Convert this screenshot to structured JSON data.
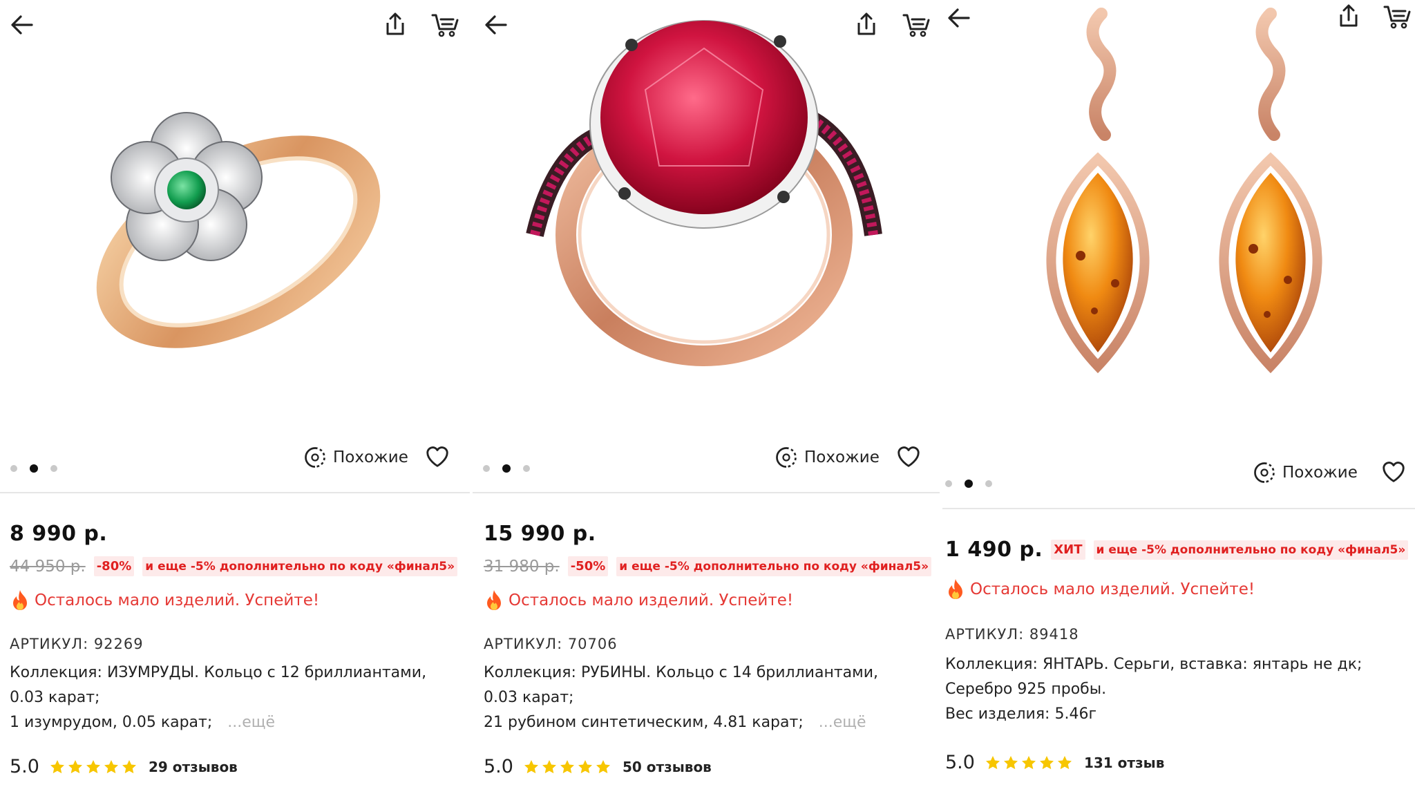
{
  "colors": {
    "accent": "#e53935",
    "badge_bg": "#fdeaea",
    "star": "#f7c600",
    "old_price": "#9a9a9a"
  },
  "icons": [
    "arrow-left-icon",
    "share-icon",
    "cart-icon",
    "similar-icon",
    "heart-icon",
    "fire-icon",
    "star-icon"
  ],
  "panels": [
    {
      "product": "emerald flower ring",
      "price": "8 990 р.",
      "old_price": "44 950 р.",
      "discount": "-80%",
      "promo": "и еще -5% дополнительно по коду «финал5»",
      "similar_label": "Похожие",
      "stock_warning": "Осталось мало изделий. Успейте!",
      "sku": "АРТИКУЛ: 92269",
      "description": [
        "Коллекция: ИЗУМРУДЫ. Кольцо с 12 бриллиантами,",
        "0.03 карат;",
        "1 изумрудом, 0.05 карат;"
      ],
      "more_label": "...ещё",
      "rating": "5.0",
      "stars": 5,
      "reviews": "29 отзывов",
      "active_slide": 2,
      "slides": 3
    },
    {
      "product": "ruby ring",
      "price": "15 990 р.",
      "old_price": "31 980 р.",
      "discount": "-50%",
      "promo": "и еще -5% дополнительно по коду «финал5»",
      "similar_label": "Похожие",
      "stock_warning": "Осталось мало изделий. Успейте!",
      "sku": "АРТИКУЛ: 70706",
      "description": [
        "Коллекция: РУБИНЫ. Кольцо с 14 бриллиантами,",
        "0.03 карат;",
        "21 рубином синтетическим, 4.81 карат;"
      ],
      "more_label": "...ещё",
      "rating": "5.0",
      "stars": 5,
      "reviews": "50 отзывов",
      "active_slide": 2,
      "slides": 3
    },
    {
      "product": "amber earrings",
      "price": "1 490 р.",
      "hit_badge": "ХИТ",
      "promo": "и еще -5% дополнительно по коду «финал5»",
      "similar_label": "Похожие",
      "stock_warning": "Осталось мало изделий. Успейте!",
      "sku": "АРТИКУЛ: 89418",
      "description": [
        "Коллекция: ЯНТАРЬ. Серьги, вставка:  янтарь не дк;",
        "Серебро 925 пробы.",
        "Вес изделия: 5.46г"
      ],
      "rating": "5.0",
      "stars": 5,
      "reviews": "131 отзыв",
      "active_slide": 2,
      "slides": 3
    }
  ]
}
